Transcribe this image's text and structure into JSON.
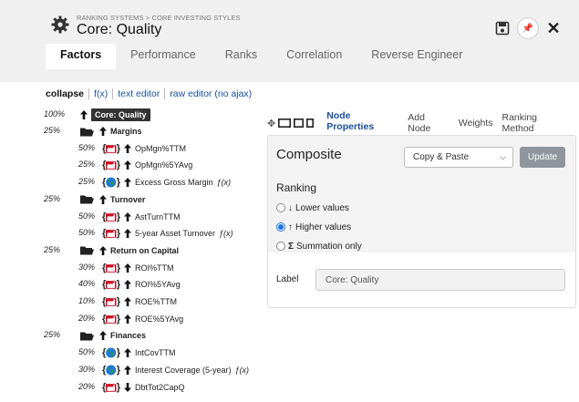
{
  "header": {
    "breadcrumb": "RANKING SYSTEMS > CORE INVESTING STYLES",
    "title": "Core: Quality",
    "icons": [
      "gear-icon",
      "save-icon",
      "pin-icon",
      "close-icon"
    ]
  },
  "tabs": [
    {
      "label": "Factors",
      "active": true
    },
    {
      "label": "Performance",
      "active": false
    },
    {
      "label": "Ranks",
      "active": false
    },
    {
      "label": "Correlation",
      "active": false
    },
    {
      "label": "Reverse Engineer",
      "active": false
    }
  ],
  "toolbar": {
    "collapse": "collapse",
    "fx": "f(x)",
    "text_editor": "text editor",
    "raw_editor": "raw editor (no ajax)"
  },
  "tree": {
    "root": {
      "pct": "100%",
      "label": "Core: Quality"
    },
    "groups": [
      {
        "pct": "25%",
        "label": "Margins",
        "items": [
          {
            "pct": "50%",
            "icon": "factory",
            "dir": "up",
            "label": "OpMgn%TTM",
            "fx": ""
          },
          {
            "pct": "25%",
            "icon": "factory",
            "dir": "up",
            "label": "OpMgn%5YAvg",
            "fx": ""
          },
          {
            "pct": "25%",
            "icon": "globe",
            "dir": "up",
            "label": "Excess Gross Margin",
            "fx": "ƒ(x)"
          }
        ]
      },
      {
        "pct": "25%",
        "label": "Turnover",
        "items": [
          {
            "pct": "50%",
            "icon": "factory",
            "dir": "up",
            "label": "AstTurnTTM",
            "fx": ""
          },
          {
            "pct": "50%",
            "icon": "factory",
            "dir": "up",
            "label": "5-year Asset Turnover",
            "fx": "ƒ(x)"
          }
        ]
      },
      {
        "pct": "25%",
        "label": "Return on Capital",
        "items": [
          {
            "pct": "30%",
            "icon": "factory",
            "dir": "up",
            "label": "ROI%TTM",
            "fx": ""
          },
          {
            "pct": "40%",
            "icon": "factory",
            "dir": "up",
            "label": "ROI%5YAvg",
            "fx": ""
          },
          {
            "pct": "10%",
            "icon": "factory",
            "dir": "up",
            "label": "ROE%TTM",
            "fx": ""
          },
          {
            "pct": "20%",
            "icon": "factory",
            "dir": "up",
            "label": "ROE%5YAvg",
            "fx": ""
          }
        ]
      },
      {
        "pct": "25%",
        "label": "Finances",
        "items": [
          {
            "pct": "50%",
            "icon": "globe",
            "dir": "up",
            "label": "IntCovTTM",
            "fx": ""
          },
          {
            "pct": "30%",
            "icon": "globe",
            "dir": "up",
            "label": "Interest Coverage (5-year)",
            "fx": "ƒ(x)"
          },
          {
            "pct": "20%",
            "icon": "factory",
            "dir": "down",
            "label": "DbtTot2CapQ",
            "fx": ""
          }
        ]
      }
    ]
  },
  "panel_tabs": [
    {
      "label": "Node Properties",
      "active": true
    },
    {
      "label": "Add Node",
      "active": false
    },
    {
      "label": "Weights",
      "active": false
    },
    {
      "label": "Ranking Method",
      "active": false
    }
  ],
  "node_panel": {
    "type_title": "Composite",
    "copy_select": "Copy & Paste",
    "update_label": "Update",
    "ranking_title": "Ranking",
    "options": [
      {
        "symbol": "↓",
        "label": "Lower values",
        "selected": false
      },
      {
        "symbol": "↑",
        "label": "Higher values",
        "selected": true
      },
      {
        "symbol": "Σ",
        "label": "Summation only",
        "selected": false
      }
    ],
    "label_key": "Label",
    "label_value": "Core: Quality"
  },
  "colors": {
    "accent": "#1a4fa0",
    "factory_red": "#d0021b",
    "globe_blue": "#1e7ad6",
    "globe_green": "#2e9b3a"
  }
}
